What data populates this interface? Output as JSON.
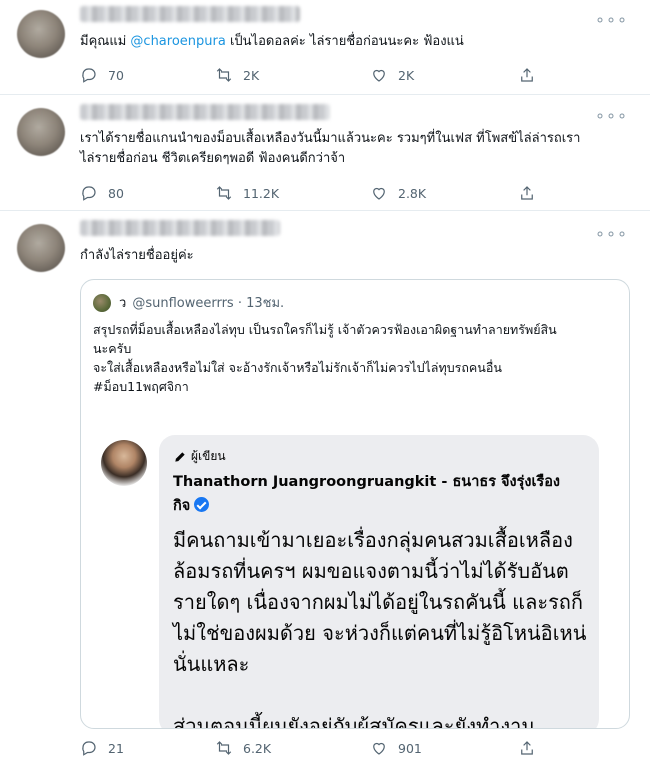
{
  "tweets": [
    {
      "text_before": "มีคุณแม่ ",
      "mention": "@charoenpura",
      "text_after": " เป็นไอดอลค่ะ ไล่รายชื่อก่อนนะคะ ฟ้องแน่",
      "replies": "70",
      "retweets": "2K",
      "likes": "2K"
    },
    {
      "text": "เราได้รายชื่อแกนนำของม็อบเสื้อเหลืองวันนี้มาแล้วนะคะ รวมๆที่ในเฟส ที่โพสข้ไล่ล่ารถเรา\nไล่รายชื่อก่อน ชีวิตเครียดๆพอดี ฟ้องคนดีกว่าจ้า",
      "replies": "80",
      "retweets": "11.2K",
      "likes": "2.8K"
    },
    {
      "text": "กำลังไล่รายชื่ออยู่ค่ะ",
      "replies": "21",
      "retweets": "6.2K",
      "likes": "901",
      "quote": {
        "display_name": "ว",
        "handle_time": "@sunfloweerrrs · 13ชม.",
        "text": "สรุปรถที่ม็อบเสื้อเหลืองไล่ทุบ เป็นรถใครก็ไม่รู้ เจ้าตัวควรฟ้องเอาผิดฐานทำลายทรัพย์สิน\nนะครับ\nจะใส่เสื้อเหลืองหรือไม่ใส่ จะอ้างรักเจ้าหรือไม่รักเจ้าก็ไม่ควรไปไล่ทุบรถคนอื่น\n#ม็อบ11พฤศจิกา",
        "fb_post": {
          "author_label": "ผู้เขียน",
          "name": "Thanathorn Juangroongruangkit - ธนาธร จึงรุ่งเรือง\nกิจ",
          "body": "มีคนถามเข้ามาเยอะเรื่องกลุ่มคนสวมเสื้อเหลือง\nล้อมรถที่นครฯ ผมขอแจงตามนี้ว่าไม่ได้รับอันต\nรายใดๆ เนื่องจากผมไม่ได้อยู่ในรถคันนี้ และรถก็\nไม่ใช่ของผมด้วย จะห่วงก็แต่คนที่ไม่รู้อิโหน่อิเหน่\nนั่นแหละ\n\nส่วนตอนนี้ผมยังอยู่กับผู้สมัครและยังทำงาน"
        }
      }
    }
  ],
  "more_label": "∘∘∘"
}
